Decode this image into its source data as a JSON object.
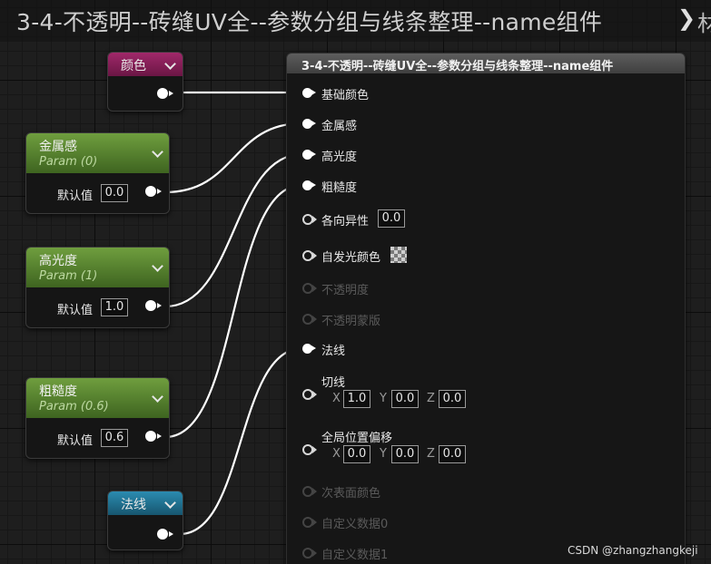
{
  "breadcrumb": {
    "title": "3-4-不透明--砖缝UV全--参数分组与线条整理--name组件",
    "overflow_text": "材"
  },
  "color_param": {
    "label": "颜色"
  },
  "scalar_params": [
    {
      "name": "金属感",
      "param": "Param (0)",
      "default_label": "默认值",
      "value": "0.0"
    },
    {
      "name": "高光度",
      "param": "Param (1)",
      "default_label": "默认值",
      "value": "1.0"
    },
    {
      "name": "粗糙度",
      "param": "Param (0.6)",
      "default_label": "默认值",
      "value": "0.6"
    }
  ],
  "normal_param": {
    "label": "法线"
  },
  "function_node": {
    "title": "3-4-不透明--砖缝UV全--参数分组与线条整理--name组件",
    "inputs": [
      {
        "label": "基础颜色",
        "state": "connected"
      },
      {
        "label": "金属感",
        "state": "connected"
      },
      {
        "label": "高光度",
        "state": "connected"
      },
      {
        "label": "粗糙度",
        "state": "connected"
      },
      {
        "label": "各向异性",
        "state": "open",
        "value": "0.0"
      },
      {
        "label": "自发光颜色",
        "state": "open",
        "swatch": "checker"
      },
      {
        "label": "不透明度",
        "state": "disabled"
      },
      {
        "label": "不透明蒙版",
        "state": "disabled"
      },
      {
        "label": "法线",
        "state": "connected"
      },
      {
        "label": "切线",
        "state": "open",
        "x": "1.0",
        "y": "0.0",
        "z": "0.0"
      },
      {
        "label": "全局位置偏移",
        "state": "open",
        "x": "0.0",
        "y": "0.0",
        "z": "0.0"
      },
      {
        "label": "次表面颜色",
        "state": "disabled"
      },
      {
        "label": "自定义数据0",
        "state": "disabled"
      },
      {
        "label": "自定义数据1",
        "state": "disabled"
      }
    ],
    "axis_labels": {
      "x": "X",
      "y": "Y",
      "z": "Z"
    }
  },
  "watermark": "CSDN @zhangzhangkeji",
  "colors": {
    "color_param_header": "#8a1f5a",
    "scalar_param_header": "#5a8a30",
    "normal_param_header": "#2383a8",
    "function_header": "#4e4e4e",
    "wire": "#ffffff"
  }
}
